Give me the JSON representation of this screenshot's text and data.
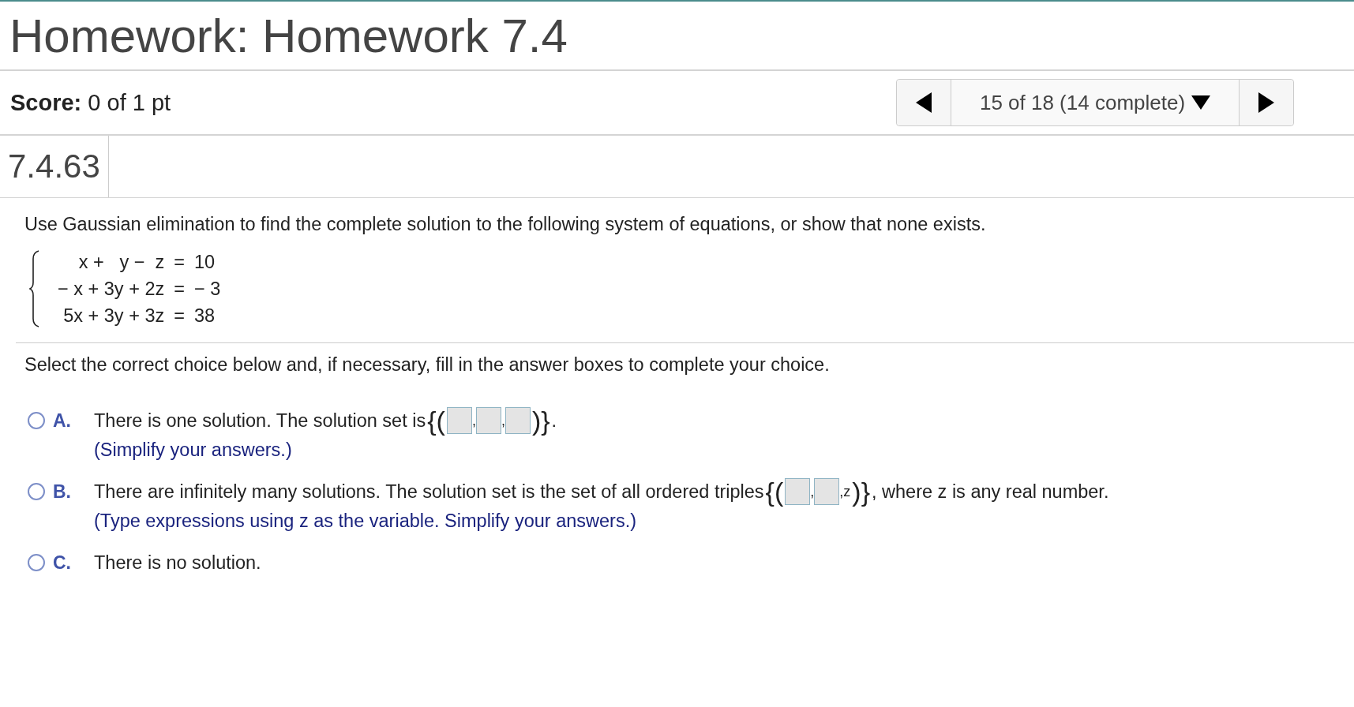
{
  "title": "Homework: Homework 7.4",
  "score": {
    "label": "Score:",
    "value": "0 of 1 pt"
  },
  "navigator": {
    "position": "15 of 18 (14 complete)"
  },
  "problem_id": "7.4.63",
  "question": "Use Gaussian elimination to find the complete solution to the following system of equations, or show that none exists.",
  "equations": [
    {
      "terms": [
        "x +",
        "y −",
        "z"
      ],
      "relation": "=",
      "rhs": "10"
    },
    {
      "terms": [
        "− x + ",
        "3y + ",
        "2z"
      ],
      "relation": "=",
      "rhs": "− 3"
    },
    {
      "terms": [
        "5x + ",
        "3y + ",
        "3z"
      ],
      "relation": "=",
      "rhs": "38"
    }
  ],
  "instruction": "Select the correct choice below and, if necessary, fill in the answer boxes to complete your choice.",
  "choices": [
    {
      "letter": "A.",
      "selected": false,
      "segments": [
        {
          "kind": "text",
          "text": "There is one solution. The solution set is"
        },
        {
          "kind": "bracket",
          "text": "{("
        },
        {
          "kind": "box"
        },
        {
          "kind": "comma",
          "text": ","
        },
        {
          "kind": "box"
        },
        {
          "kind": "comma",
          "text": ","
        },
        {
          "kind": "box"
        },
        {
          "kind": "bracket",
          "text": ")}"
        },
        {
          "kind": "text",
          "text": "."
        }
      ],
      "hint": "(Simplify your answers.)"
    },
    {
      "letter": "B.",
      "selected": false,
      "segments": [
        {
          "kind": "text",
          "text": "There are infinitely many solutions. The solution set is the set of all ordered triples"
        },
        {
          "kind": "bracket",
          "text": "{("
        },
        {
          "kind": "box"
        },
        {
          "kind": "comma",
          "text": ","
        },
        {
          "kind": "box"
        },
        {
          "kind": "comma",
          "text": ",z"
        },
        {
          "kind": "bracket",
          "text": ")}"
        },
        {
          "kind": "text",
          "text": ", where z is any real number."
        }
      ],
      "hint": "(Type expressions using z as the variable. Simplify your answers.)"
    },
    {
      "letter": "C.",
      "selected": false,
      "segments": [
        {
          "kind": "text",
          "text": "There is no solution."
        }
      ]
    }
  ]
}
